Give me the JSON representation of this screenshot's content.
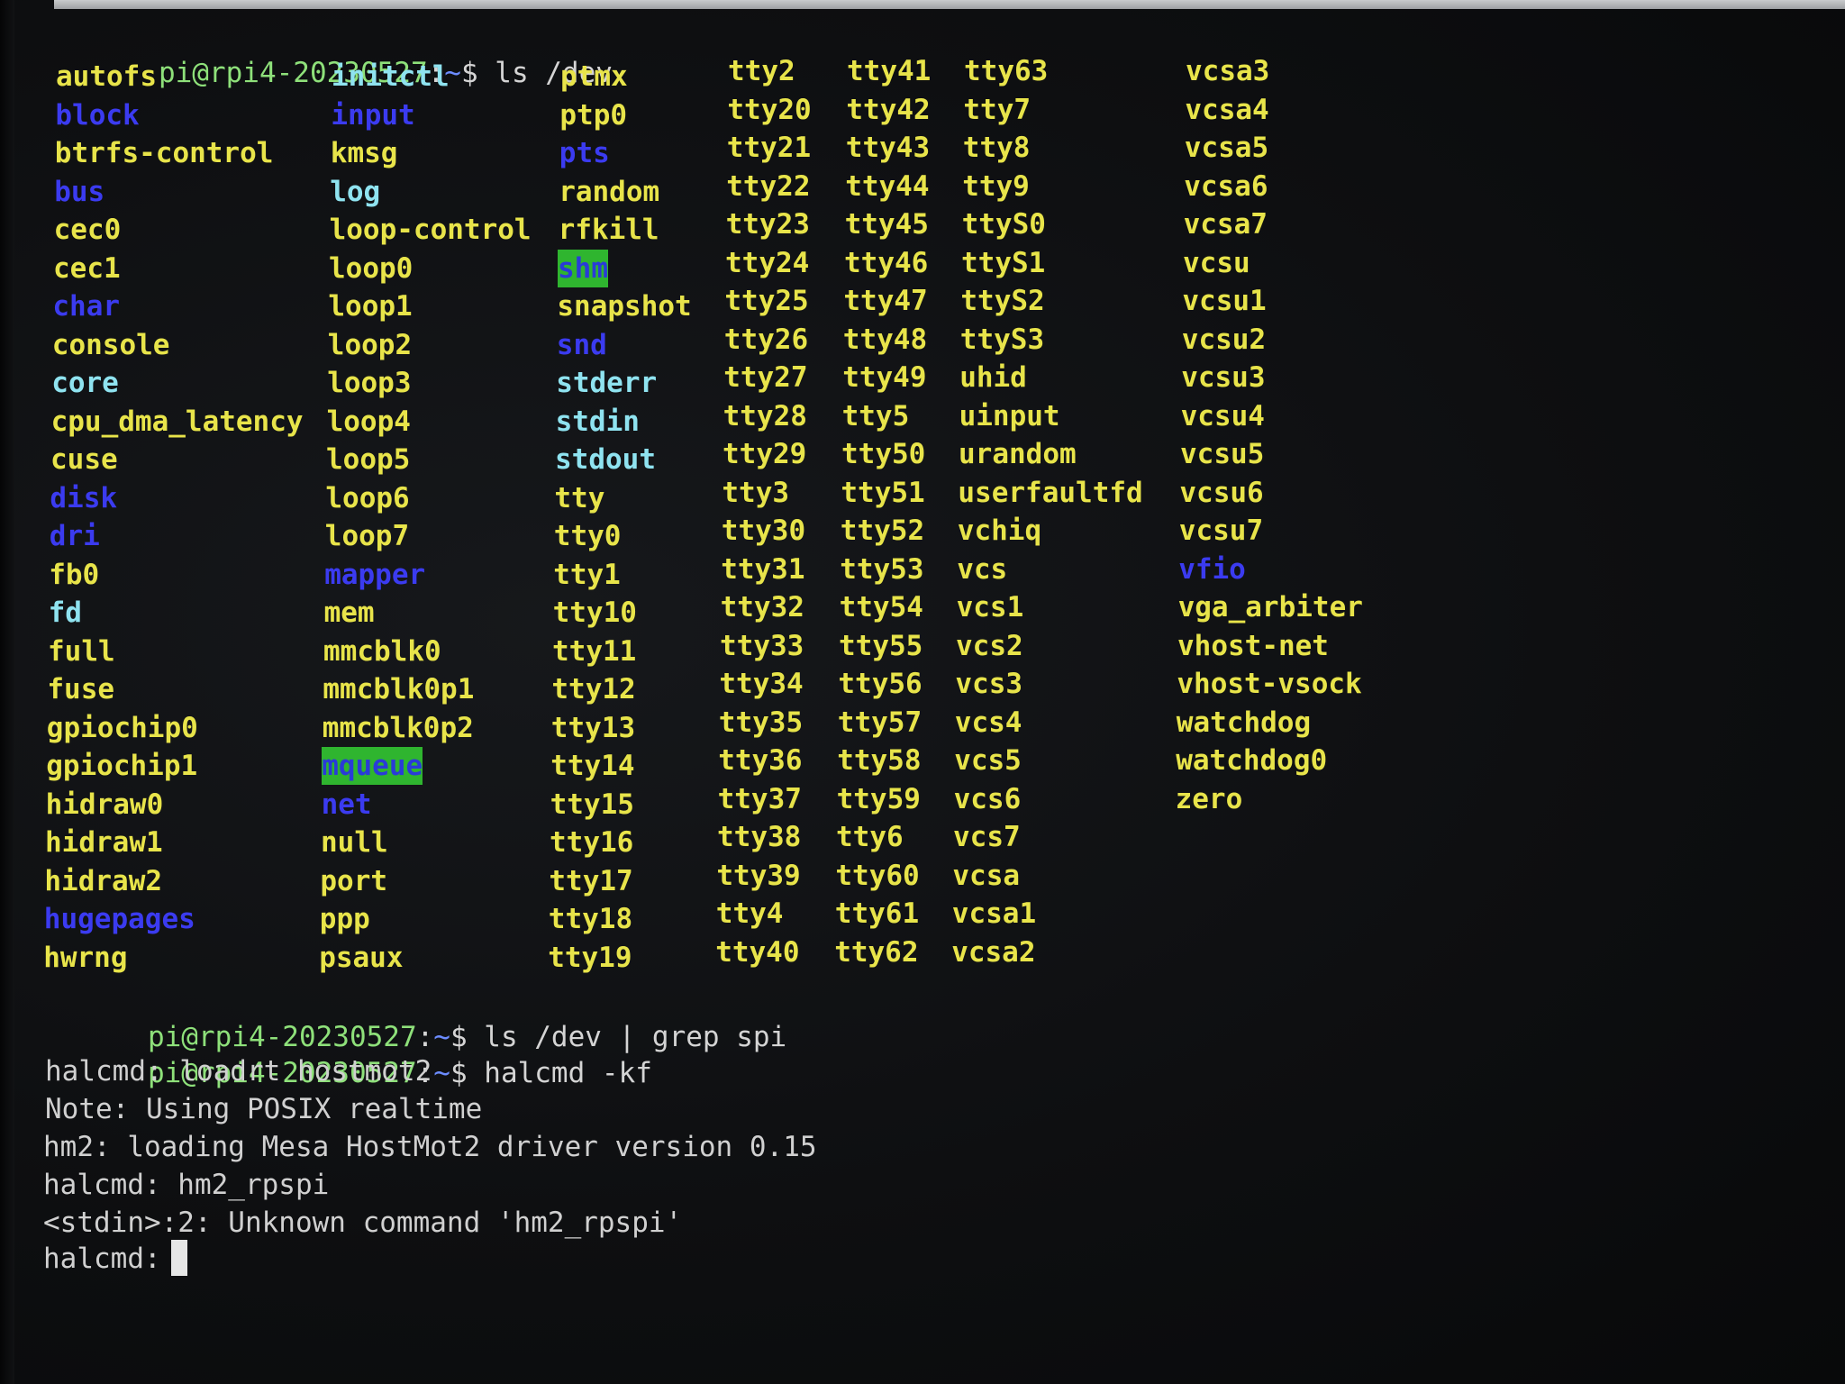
{
  "prompt": {
    "user_host": "pi@rpi4-20230527",
    "colon": ":",
    "path": "~",
    "dollar": "$ "
  },
  "commands": [
    "ls /dev",
    "ls /dev | grep spi",
    "halcmd -kf"
  ],
  "ls_columns": [
    [
      {
        "name": "autofs",
        "color": "yellow"
      },
      {
        "name": "block",
        "color": "blue"
      },
      {
        "name": "btrfs-control",
        "color": "yellow"
      },
      {
        "name": "bus",
        "color": "blue"
      },
      {
        "name": "cec0",
        "color": "yellow"
      },
      {
        "name": "cec1",
        "color": "yellow"
      },
      {
        "name": "char",
        "color": "blue"
      },
      {
        "name": "console",
        "color": "yellow"
      },
      {
        "name": "core",
        "color": "cyan"
      },
      {
        "name": "cpu_dma_latency",
        "color": "yellow"
      },
      {
        "name": "cuse",
        "color": "yellow"
      },
      {
        "name": "disk",
        "color": "blue"
      },
      {
        "name": "dri",
        "color": "blue"
      },
      {
        "name": "fb0",
        "color": "yellow"
      },
      {
        "name": "fd",
        "color": "cyan"
      },
      {
        "name": "full",
        "color": "yellow"
      },
      {
        "name": "fuse",
        "color": "yellow"
      },
      {
        "name": "gpiochip0",
        "color": "yellow"
      },
      {
        "name": "gpiochip1",
        "color": "yellow"
      },
      {
        "name": "hidraw0",
        "color": "yellow"
      },
      {
        "name": "hidraw1",
        "color": "yellow"
      },
      {
        "name": "hidraw2",
        "color": "yellow"
      },
      {
        "name": "hugepages",
        "color": "blue"
      },
      {
        "name": "hwrng",
        "color": "yellow"
      }
    ],
    [
      {
        "name": "initctl",
        "color": "cyan"
      },
      {
        "name": "input",
        "color": "blue"
      },
      {
        "name": "kmsg",
        "color": "yellow"
      },
      {
        "name": "log",
        "color": "cyan"
      },
      {
        "name": "loop-control",
        "color": "yellow"
      },
      {
        "name": "loop0",
        "color": "yellow"
      },
      {
        "name": "loop1",
        "color": "yellow"
      },
      {
        "name": "loop2",
        "color": "yellow"
      },
      {
        "name": "loop3",
        "color": "yellow"
      },
      {
        "name": "loop4",
        "color": "yellow"
      },
      {
        "name": "loop5",
        "color": "yellow"
      },
      {
        "name": "loop6",
        "color": "yellow"
      },
      {
        "name": "loop7",
        "color": "yellow"
      },
      {
        "name": "mapper",
        "color": "blue"
      },
      {
        "name": "mem",
        "color": "yellow"
      },
      {
        "name": "mmcblk0",
        "color": "yellow"
      },
      {
        "name": "mmcblk0p1",
        "color": "yellow"
      },
      {
        "name": "mmcblk0p2",
        "color": "yellow"
      },
      {
        "name": "mqueue",
        "color": "hl"
      },
      {
        "name": "net",
        "color": "blue"
      },
      {
        "name": "null",
        "color": "yellow"
      },
      {
        "name": "port",
        "color": "yellow"
      },
      {
        "name": "ppp",
        "color": "yellow"
      },
      {
        "name": "psaux",
        "color": "yellow"
      }
    ],
    [
      {
        "name": "ptmx",
        "color": "yellow"
      },
      {
        "name": "ptp0",
        "color": "yellow"
      },
      {
        "name": "pts",
        "color": "blue"
      },
      {
        "name": "random",
        "color": "yellow"
      },
      {
        "name": "rfkill",
        "color": "yellow"
      },
      {
        "name": "shm",
        "color": "hl"
      },
      {
        "name": "snapshot",
        "color": "yellow"
      },
      {
        "name": "snd",
        "color": "blue"
      },
      {
        "name": "stderr",
        "color": "cyan"
      },
      {
        "name": "stdin",
        "color": "cyan"
      },
      {
        "name": "stdout",
        "color": "cyan"
      },
      {
        "name": "tty",
        "color": "yellow"
      },
      {
        "name": "tty0",
        "color": "yellow"
      },
      {
        "name": "tty1",
        "color": "yellow"
      },
      {
        "name": "tty10",
        "color": "yellow"
      },
      {
        "name": "tty11",
        "color": "yellow"
      },
      {
        "name": "tty12",
        "color": "yellow"
      },
      {
        "name": "tty13",
        "color": "yellow"
      },
      {
        "name": "tty14",
        "color": "yellow"
      },
      {
        "name": "tty15",
        "color": "yellow"
      },
      {
        "name": "tty16",
        "color": "yellow"
      },
      {
        "name": "tty17",
        "color": "yellow"
      },
      {
        "name": "tty18",
        "color": "yellow"
      },
      {
        "name": "tty19",
        "color": "yellow"
      }
    ],
    [
      {
        "name": "tty2",
        "color": "yellow"
      },
      {
        "name": "tty20",
        "color": "yellow"
      },
      {
        "name": "tty21",
        "color": "yellow"
      },
      {
        "name": "tty22",
        "color": "yellow"
      },
      {
        "name": "tty23",
        "color": "yellow"
      },
      {
        "name": "tty24",
        "color": "yellow"
      },
      {
        "name": "tty25",
        "color": "yellow"
      },
      {
        "name": "tty26",
        "color": "yellow"
      },
      {
        "name": "tty27",
        "color": "yellow"
      },
      {
        "name": "tty28",
        "color": "yellow"
      },
      {
        "name": "tty29",
        "color": "yellow"
      },
      {
        "name": "tty3",
        "color": "yellow"
      },
      {
        "name": "tty30",
        "color": "yellow"
      },
      {
        "name": "tty31",
        "color": "yellow"
      },
      {
        "name": "tty32",
        "color": "yellow"
      },
      {
        "name": "tty33",
        "color": "yellow"
      },
      {
        "name": "tty34",
        "color": "yellow"
      },
      {
        "name": "tty35",
        "color": "yellow"
      },
      {
        "name": "tty36",
        "color": "yellow"
      },
      {
        "name": "tty37",
        "color": "yellow"
      },
      {
        "name": "tty38",
        "color": "yellow"
      },
      {
        "name": "tty39",
        "color": "yellow"
      },
      {
        "name": "tty4",
        "color": "yellow"
      },
      {
        "name": "tty40",
        "color": "yellow"
      }
    ],
    [
      {
        "name": "tty41",
        "color": "yellow"
      },
      {
        "name": "tty42",
        "color": "yellow"
      },
      {
        "name": "tty43",
        "color": "yellow"
      },
      {
        "name": "tty44",
        "color": "yellow"
      },
      {
        "name": "tty45",
        "color": "yellow"
      },
      {
        "name": "tty46",
        "color": "yellow"
      },
      {
        "name": "tty47",
        "color": "yellow"
      },
      {
        "name": "tty48",
        "color": "yellow"
      },
      {
        "name": "tty49",
        "color": "yellow"
      },
      {
        "name": "tty5",
        "color": "yellow"
      },
      {
        "name": "tty50",
        "color": "yellow"
      },
      {
        "name": "tty51",
        "color": "yellow"
      },
      {
        "name": "tty52",
        "color": "yellow"
      },
      {
        "name": "tty53",
        "color": "yellow"
      },
      {
        "name": "tty54",
        "color": "yellow"
      },
      {
        "name": "tty55",
        "color": "yellow"
      },
      {
        "name": "tty56",
        "color": "yellow"
      },
      {
        "name": "tty57",
        "color": "yellow"
      },
      {
        "name": "tty58",
        "color": "yellow"
      },
      {
        "name": "tty59",
        "color": "yellow"
      },
      {
        "name": "tty6",
        "color": "yellow"
      },
      {
        "name": "tty60",
        "color": "yellow"
      },
      {
        "name": "tty61",
        "color": "yellow"
      },
      {
        "name": "tty62",
        "color": "yellow"
      }
    ],
    [
      {
        "name": "tty63",
        "color": "yellow"
      },
      {
        "name": "tty7",
        "color": "yellow"
      },
      {
        "name": "tty8",
        "color": "yellow"
      },
      {
        "name": "tty9",
        "color": "yellow"
      },
      {
        "name": "ttyS0",
        "color": "yellow"
      },
      {
        "name": "ttyS1",
        "color": "yellow"
      },
      {
        "name": "ttyS2",
        "color": "yellow"
      },
      {
        "name": "ttyS3",
        "color": "yellow"
      },
      {
        "name": "uhid",
        "color": "yellow"
      },
      {
        "name": "uinput",
        "color": "yellow"
      },
      {
        "name": "urandom",
        "color": "yellow"
      },
      {
        "name": "userfaultfd",
        "color": "yellow"
      },
      {
        "name": "vchiq",
        "color": "yellow"
      },
      {
        "name": "vcs",
        "color": "yellow"
      },
      {
        "name": "vcs1",
        "color": "yellow"
      },
      {
        "name": "vcs2",
        "color": "yellow"
      },
      {
        "name": "vcs3",
        "color": "yellow"
      },
      {
        "name": "vcs4",
        "color": "yellow"
      },
      {
        "name": "vcs5",
        "color": "yellow"
      },
      {
        "name": "vcs6",
        "color": "yellow"
      },
      {
        "name": "vcs7",
        "color": "yellow"
      },
      {
        "name": "vcsa",
        "color": "yellow"
      },
      {
        "name": "vcsa1",
        "color": "yellow"
      },
      {
        "name": "vcsa2",
        "color": "yellow"
      }
    ],
    [
      {
        "name": "vcsa3",
        "color": "yellow"
      },
      {
        "name": "vcsa4",
        "color": "yellow"
      },
      {
        "name": "vcsa5",
        "color": "yellow"
      },
      {
        "name": "vcsa6",
        "color": "yellow"
      },
      {
        "name": "vcsa7",
        "color": "yellow"
      },
      {
        "name": "vcsu",
        "color": "yellow"
      },
      {
        "name": "vcsu1",
        "color": "yellow"
      },
      {
        "name": "vcsu2",
        "color": "yellow"
      },
      {
        "name": "vcsu3",
        "color": "yellow"
      },
      {
        "name": "vcsu4",
        "color": "yellow"
      },
      {
        "name": "vcsu5",
        "color": "yellow"
      },
      {
        "name": "vcsu6",
        "color": "yellow"
      },
      {
        "name": "vcsu7",
        "color": "yellow"
      },
      {
        "name": "vfio",
        "color": "blue"
      },
      {
        "name": "vga_arbiter",
        "color": "yellow"
      },
      {
        "name": "vhost-net",
        "color": "yellow"
      },
      {
        "name": "vhost-vsock",
        "color": "yellow"
      },
      {
        "name": "watchdog",
        "color": "yellow"
      },
      {
        "name": "watchdog0",
        "color": "yellow"
      },
      {
        "name": "zero",
        "color": "yellow"
      }
    ]
  ],
  "halcmd_output": [
    "halcmd: loadrt hostmot2",
    "Note: Using POSIX realtime",
    "hm2: loading Mesa HostMot2 driver version 0.15",
    "halcmd: hm2_rpspi",
    "<stdin>:2: Unknown command 'hm2_rpspi'"
  ],
  "current_prompt": "halcmd: ",
  "colors": {
    "yellow": "#e8e44a",
    "cyan": "#8fe3f0",
    "blue": "#3b3bf0",
    "highlight_bg": "#2fb52f",
    "prompt_user": "#8ee07a",
    "prompt_path": "#6c8cff"
  }
}
